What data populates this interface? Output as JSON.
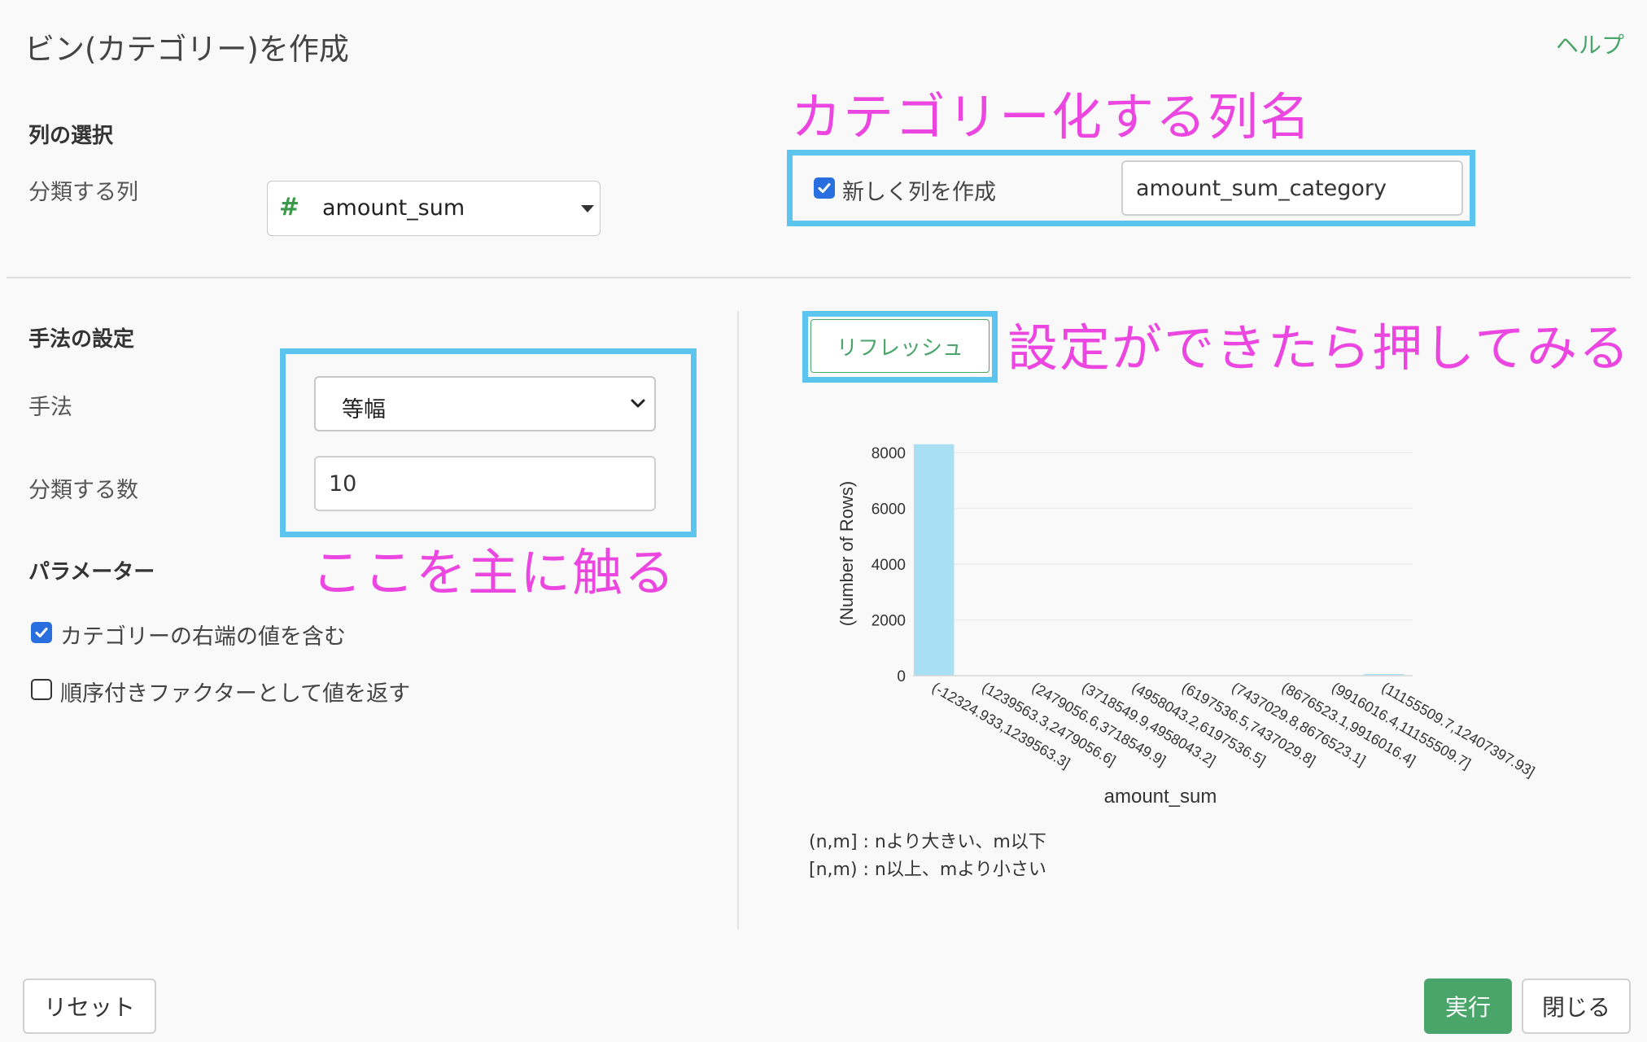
{
  "dialog": {
    "title": "ビン(カテゴリー)を作成",
    "help_link": "ヘルプ"
  },
  "column_section": {
    "heading": "列の選択",
    "classify_column_label": "分類する列",
    "selected_column": "amount_sum",
    "selected_column_type_icon": "#",
    "new_column_checkbox_label": "新しく列を作成",
    "new_column_checked": true,
    "new_column_name": "amount_sum_category"
  },
  "method_section": {
    "heading": "手法の設定",
    "method_label": "手法",
    "method_value": "等幅",
    "count_label": "分類する数",
    "count_value": "10"
  },
  "params_section": {
    "heading": "パラメーター",
    "include_right_label": "カテゴリーの右端の値を含む",
    "include_right_checked": true,
    "ordered_factor_label": "順序付きファクターとして値を返す",
    "ordered_factor_checked": false
  },
  "refresh_button": "リフレッシュ",
  "annotations": {
    "column_name": "カテゴリー化する列名",
    "refresh_hint": "設定ができたら押してみる",
    "main_controls": "ここを主に触る"
  },
  "chart_data": {
    "type": "bar",
    "xlabel": "amount_sum",
    "ylabel": "(Number of Rows)",
    "ylim": [
      0,
      8000
    ],
    "yticks": [
      0,
      2000,
      4000,
      6000,
      8000
    ],
    "categories": [
      "(-12324.933,1239563.3]",
      "(1239563.3,2479056.6]",
      "(2479056.6,3718549.9]",
      "(3718549.9,4958043.2]",
      "(4958043.2,6197536.5]",
      "(6197536.5,7437029.8]",
      "(7437029.8,8676523.1]",
      "(8676523.1,9916016.4]",
      "(9916016.4,11155509.7]",
      "(11155509.7,12407397.93]"
    ],
    "values": [
      8300,
      0,
      0,
      0,
      0,
      0,
      0,
      0,
      0,
      30
    ],
    "bar_color": "#a8dff2",
    "grid": true
  },
  "legend_notes": {
    "note1": "(n,m] : nより大きい、m以下",
    "note2": "[n,m) : n以上、mより小さい"
  },
  "footer": {
    "reset_button": "リセット",
    "run_button": "実行",
    "close_button": "閉じる"
  },
  "colors": {
    "accent_green": "#4aa56a",
    "annotation_box": "#5bc4ef",
    "annotation_text": "#ec46e0",
    "checkbox_blue": "#2a6fe0"
  }
}
